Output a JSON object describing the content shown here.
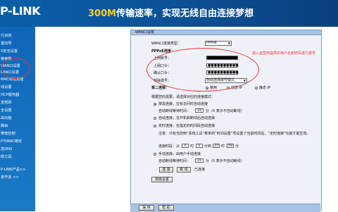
{
  "banner": {
    "logo": "P-LINK",
    "slogan_highlight": "300M",
    "slogan_rest": "传输速率，实现无线自由连接梦想"
  },
  "sidebar": {
    "items": [
      "行状态",
      "置向导",
      "S安全设置",
      "络参数",
      "WAN口设置",
      "LAN口设置",
      "MAC地址克隆",
      "线设置",
      "HCP服务器",
      "发规则",
      "全设置",
      "由功能",
      "路由",
      "带宽控制",
      "P与MAC绑定",
      "态DNS",
      "统工具",
      "P-LINK产品>>",
      "单开多 >>"
    ]
  },
  "panel": {
    "title": "WAN口设置",
    "wan_type_label": "WAN口连接类型：",
    "wan_type_value": "PPPoE",
    "pppoe_label": "PPPoE连接：",
    "username_label": "上网账号：",
    "password_label": "上网口令：",
    "confirm_label": "确认口令：",
    "password_mask": "●●●●●●●●●●",
    "special_label": "特殊拨号：",
    "special_value": "自动选择拨号模式",
    "second_conn_label": "第二连接：",
    "second_opts": [
      "禁用",
      "动态 IP",
      "静态 IP"
    ],
    "mode_prompt": "根据您的需要，请选择对应的连接模式：",
    "opt1": "按需连接，在有访问时自动连接",
    "idle1_label": "自动断线等待时间：",
    "idle1_value": "15",
    "idle1_unit": "分（0 表示不自动断线）",
    "opt2": "自动连接，在开机和断线后自动连接",
    "opt3": "定时连接，在指定的时间段自动连接",
    "note": "注意：只有当您到“系统工具”菜单的“时间设置”项设置了当前时间后，“定时连接”功能才能生效。",
    "period_label": "连接时段：从",
    "t1": "0",
    "t1_unit": "时",
    "t2": "0",
    "t2_unit": "分到",
    "t3": "23",
    "t3_unit": "时",
    "t4": "59",
    "t4_unit": "分",
    "opt4": "手动连接，由用户手动连接",
    "idle2_label": "自动断线等待时间：",
    "idle2_value": "15",
    "idle2_unit": "分（0 表示不自动断线）",
    "connect_btn": "连 接",
    "disconnect_btn": "断 线",
    "status": "已连接",
    "advanced_btn": "高级设置",
    "save_btn": "保 存",
    "help_btn": "帮 助"
  },
  "annotation": "填入运营商提供的用户名和密码进行拨号"
}
